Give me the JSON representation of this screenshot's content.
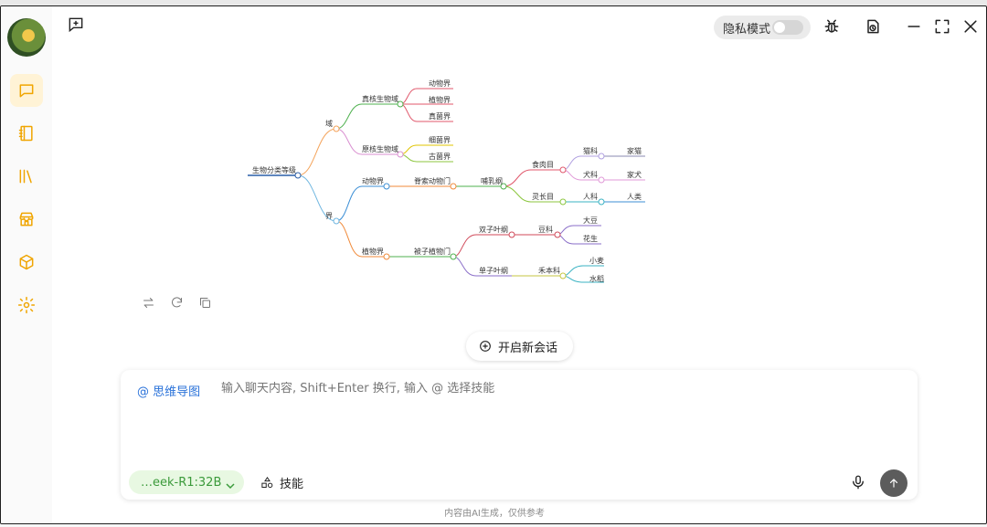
{
  "header": {
    "privacy_label": "隐私模式",
    "privacy_enabled": false
  },
  "sidebar": {
    "items": [
      {
        "icon": "chat-icon",
        "active": true
      },
      {
        "icon": "notebook-icon",
        "active": false
      },
      {
        "icon": "library-icon",
        "active": false
      },
      {
        "icon": "store-icon",
        "active": false
      },
      {
        "icon": "cube-icon",
        "active": false
      },
      {
        "icon": "settings-icon",
        "active": false
      }
    ]
  },
  "mindmap": {
    "root": "生物分类等级",
    "nodes": {
      "domain": "域",
      "eukaryote": "真核生物域",
      "animal_k": "动物界",
      "plant_k": "植物界",
      "fungi_k": "真菌界",
      "prokaryote": "原核生物域",
      "bacteria": "细菌界",
      "archaea": "古菌界",
      "kingdom": "界",
      "animal": "动物界",
      "chordata": "脊索动物门",
      "mammalia": "哺乳纲",
      "carnivora": "食肉目",
      "felidae": "猫科",
      "cat": "家猫",
      "canidae": "犬科",
      "dog": "家犬",
      "primates": "灵长目",
      "hominidae": "人科",
      "human": "人类",
      "plant": "植物界",
      "angiosperm": "被子植物门",
      "dicot": "双子叶纲",
      "fabaceae": "豆科",
      "soybean": "大豆",
      "peanut": "花生",
      "monocot": "单子叶纲",
      "poaceae": "禾本科",
      "wheat": "小麦",
      "rice": "水稻"
    }
  },
  "new_session_label": "开启新会话",
  "composer": {
    "skill_tag": "@ 思维导图",
    "placeholder": "输入聊天内容, Shift+Enter 换行, 输入 @ 选择技能",
    "model": "…eek-R1:32B",
    "skills_label": "技能"
  },
  "disclaimer": "内容由AI生成，仅供参考",
  "colors": {
    "accent": "#f0a500",
    "tag_blue": "#2a72d9",
    "model_green": "#3b9a3b"
  }
}
